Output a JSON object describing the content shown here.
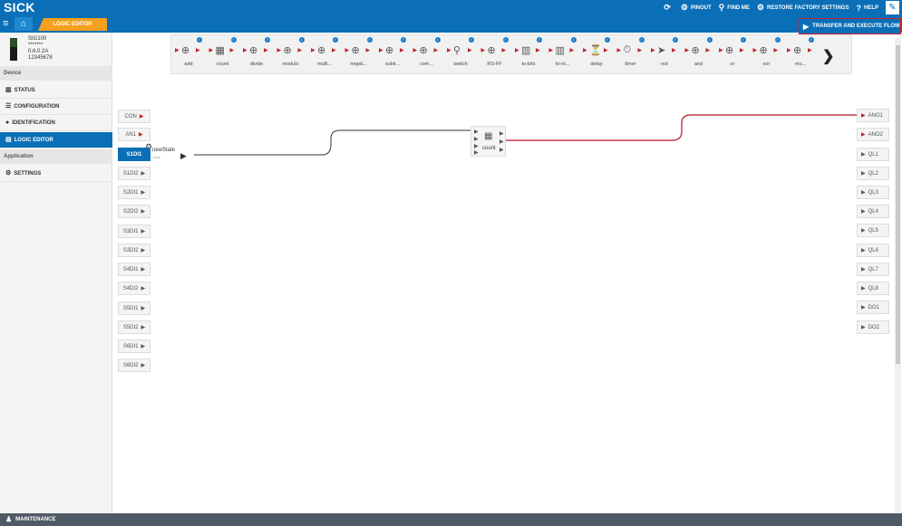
{
  "app": {
    "logo": "SICK"
  },
  "topmenu": {
    "refresh_icon": "refresh-icon",
    "pinout": "PINOUT",
    "find_me": "FIND ME",
    "restore": "RESTORE FACTORY SETTINGS",
    "help": "HELP"
  },
  "breadcrumb": {
    "current": "LOGIC EDITOR"
  },
  "toolbar": {
    "transfer": "TRANSFER AND EXECUTE FLOW"
  },
  "device": {
    "name": "SIG100",
    "masked": "*******",
    "version": "0.6.0.2A",
    "serial": "12345678"
  },
  "sidebar": {
    "device_header": "Device",
    "application_header": "Application",
    "items": [
      {
        "label": "STATUS",
        "icon": "chart-icon"
      },
      {
        "label": "CONFIGURATION",
        "icon": "list-icon"
      },
      {
        "label": "IDENTIFICATION",
        "icon": "info-icon"
      },
      {
        "label": "LOGIC EDITOR",
        "icon": "editor-icon"
      },
      {
        "label": "SETTINGS",
        "icon": "gear-icon"
      }
    ]
  },
  "palette": [
    {
      "label": "add"
    },
    {
      "label": "count"
    },
    {
      "label": "divide"
    },
    {
      "label": "modulo"
    },
    {
      "label": "multi..."
    },
    {
      "label": "negat..."
    },
    {
      "label": "subtr..."
    },
    {
      "label": "com..."
    },
    {
      "label": "switch"
    },
    {
      "label": "RS-FF"
    },
    {
      "label": "to-bits"
    },
    {
      "label": "to-ni..."
    },
    {
      "label": "delay"
    },
    {
      "label": "timer"
    },
    {
      "label": "not"
    },
    {
      "label": "and"
    },
    {
      "label": "or"
    },
    {
      "label": "xor"
    },
    {
      "label": "mu..."
    }
  ],
  "inputs": [
    "CON",
    "AN1",
    "S1DI1",
    "S1DI2",
    "S2DI1",
    "S2DI2",
    "S3DI1",
    "S3DI2",
    "S4DI1",
    "S4DI2",
    "S5DI1",
    "S5DI2",
    "S6DI1",
    "S6DI2"
  ],
  "outputs": [
    "ANO1",
    "ANO2",
    "QL1",
    "QL2",
    "QL3",
    "QL4",
    "QL5",
    "QL6",
    "QL7",
    "QL8",
    "DO1",
    "DO2"
  ],
  "node": {
    "label": "count"
  },
  "connection": {
    "label": "newState",
    "type": "bool"
  },
  "footer": {
    "label": "MAINTENANCE"
  }
}
